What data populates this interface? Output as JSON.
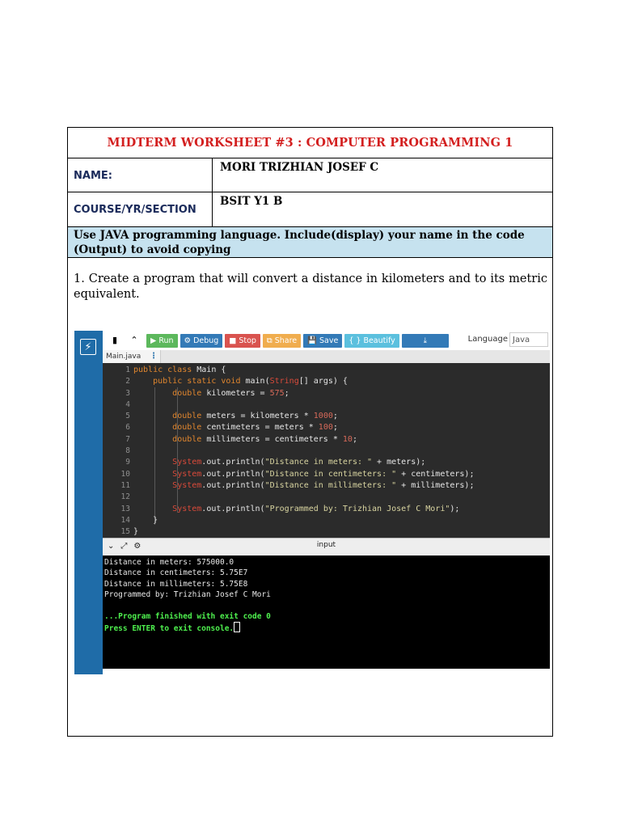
{
  "worksheet": {
    "title": "MIDTERM WORKSHEET #3 : COMPUTER PROGRAMMING 1",
    "name_label": "NAME:",
    "name_value": "MORI TRIZHIAN JOSEF C",
    "course_label": "COURSE/YR/SECTION",
    "course_value": "BSIT Y1 B",
    "instructions": "Use JAVA programming language. Include(display) your name in the code (Output) to avoid copying",
    "question": "1. Create a program that will convert a distance in kilometers and to its metric equivalent."
  },
  "ide": {
    "toolbar": {
      "run": "▶ Run",
      "debug": "⚙ Debug",
      "stop": "■ Stop",
      "share": "⧉ Share",
      "save": "💾 Save",
      "beautify": "{ } Beautify",
      "download": "⤓",
      "language_label": "Language",
      "language_value": "Java"
    },
    "tab": "Main.java",
    "line_numbers": [
      "1",
      "2",
      "3",
      "4",
      "5",
      "6",
      "7",
      "8",
      "9",
      "10",
      "11",
      "12",
      "13",
      "14",
      "15"
    ],
    "io_label": "input",
    "console": {
      "lines": [
        "Distance in meters: 575000.0",
        "Distance in centimeters: 5.75E7",
        "Distance in millimeters: 5.75E8",
        "Programmed by: Trizhian Josef C Mori"
      ],
      "finish": "...Program finished with exit code 0",
      "press_enter": "Press ENTER to exit console."
    },
    "colors": {
      "sidebar": "#1f6ca8",
      "editor_bg": "#2b2b2b",
      "keyword": "#e0862e"
    }
  },
  "title_color": "#d31f1f",
  "instruction_bg": "#c6e2ef"
}
